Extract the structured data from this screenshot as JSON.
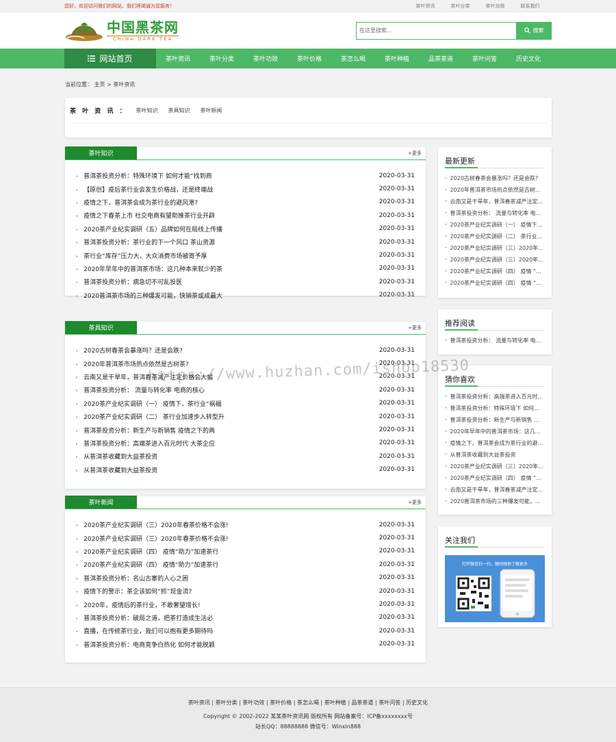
{
  "topbar": {
    "welcome": "您好，欢迎访问我们的网站，我们将竭诚为您服务！",
    "links": [
      "茶叶资讯",
      "茶叶分类",
      "茶叶功效",
      "联系我们"
    ]
  },
  "logo": {
    "cn": "中国黑茶网",
    "en": "CHINA DARK TEA"
  },
  "search": {
    "placeholder": "在这里搜索...",
    "button": "搜索"
  },
  "nav": {
    "home": "网站首页",
    "items": [
      "茶叶资讯",
      "茶叶分类",
      "茶叶功效",
      "茶叶价格",
      "茶怎么喝",
      "茶叶种植",
      "品茶茶道",
      "茶叶问答",
      "历史文化"
    ]
  },
  "breadcrumb": "当前位置： 主页 > 茶叶资讯",
  "category": {
    "title": "茶 叶 资 讯 ：",
    "links": [
      "茶叶知识",
      "茶具知识",
      "茶叶新闻"
    ]
  },
  "panels": [
    {
      "title": "茶叶知识",
      "more": "+更多",
      "items": [
        {
          "t": "普洱茶投资分析：特殊环境下 如何才能“找到商",
          "d": "2020-03-31"
        },
        {
          "t": "【原创】疫后茶行业会发生价格战，还是终端战",
          "d": "2020-03-31"
        },
        {
          "t": "疫情之下，普洱茶会成为茶行业的避风港?",
          "d": "2020-03-31"
        },
        {
          "t": "疫情之下春茶上市 社交电商有望助推茶行业开辟",
          "d": "2020-03-31"
        },
        {
          "t": "2020茶产业纪实调研（五）品牌如何在局线上传播",
          "d": "2020-03-31"
        },
        {
          "t": "普洱茶投资分析：茶行业的下一个风口 茶山资源",
          "d": "2020-03-31"
        },
        {
          "t": "茶行业“库存”压力大，大众消费市场被寄予厚",
          "d": "2020-03-31"
        },
        {
          "t": "2020年早年中的普洱茶市场：这几种本来就少的茶",
          "d": "2020-03-31"
        },
        {
          "t": "普洱茶投资分析：病急切不可乱投医",
          "d": "2020-03-31"
        },
        {
          "t": "2020普洱茶市场的三种爆发可能，快销茶或成最大",
          "d": "2020-03-31"
        }
      ]
    },
    {
      "title": "茶具知识",
      "more": "+更多",
      "items": [
        {
          "t": "2020古树春茶会暴涨吗？还是会跌?",
          "d": "2020-03-31"
        },
        {
          "t": "2020年普洱茶市场热点依然是古树茶?",
          "d": "2020-03-31"
        },
        {
          "t": "云南又是干旱年，普洱春茶减产注定价格会大幅",
          "d": "2020-03-31"
        },
        {
          "t": "普洱茶投资分析： 流量与转化率 电商的核心",
          "d": "2020-03-31"
        },
        {
          "t": "2020茶产业纪实调研（一） 疫情下，茶行业“祸福",
          "d": "2020-03-31"
        },
        {
          "t": "2020茶产业纪实调研（二） 茶行业加速步入转型升",
          "d": "2020-03-31"
        },
        {
          "t": "普洱茶投资分析：新生产与新销售 疫情之下的两",
          "d": "2020-03-31"
        },
        {
          "t": "普洱茶投资分析：高端茶进入百元时代 大茶企应",
          "d": "2020-03-31"
        },
        {
          "t": "从普洱茶收藏到大益茶投资",
          "d": "2020-03-31"
        },
        {
          "t": "从普洱茶收藏到大益茶投资",
          "d": "2020-03-31"
        }
      ]
    },
    {
      "title": "茶叶新闻",
      "more": "+更多",
      "items": [
        {
          "t": "2020茶产业纪实调研（三）2020年春茶价格不会涨!",
          "d": "2020-03-31"
        },
        {
          "t": "2020茶产业纪实调研（三）2020年春茶价格不会涨!",
          "d": "2020-03-31"
        },
        {
          "t": "2020茶产业纪实调研（四） 疫情“助力”加速茶行",
          "d": "2020-03-31"
        },
        {
          "t": "2020茶产业纪实调研（四） 疫情“助力”加速茶行",
          "d": "2020-03-31"
        },
        {
          "t": "普洱茶投资分析：名山古寨的人心之困",
          "d": "2020-03-31"
        },
        {
          "t": "疫情下的警示：茶企该如何“抓”现金流?",
          "d": "2020-03-31"
        },
        {
          "t": "2020年，疫情后的茶行业，不敢奢望增长!",
          "d": "2020-03-31"
        },
        {
          "t": "普洱茶投资分析：破局之道，把茶打造成生活必",
          "d": "2020-03-31"
        },
        {
          "t": "直播，在传统茶行业，我们可以抱有更多期待吗",
          "d": "2020-03-31"
        },
        {
          "t": "普洱茶投资分析：电商竞争白热化 如何才能脱颖",
          "d": "2020-03-31"
        }
      ]
    }
  ],
  "sidebar": {
    "latest": {
      "title": "最新更新",
      "items": [
        "2020古树春茶会暴涨吗？还是会跌?",
        "2020年普洱茶市场热点依然是古树...",
        "云南又是干旱年，普洱春茶减产注定...",
        "普洱茶投资分析： 流量与转化率 电...",
        "2020茶产业纪实调研（一） 疫情下...",
        "2020茶产业纪实调研（二） 茶行业...",
        "2020茶产业纪实调研（三）2020年...",
        "2020茶产业纪实调研（三）2020年...",
        "2020茶产业纪实调研（四） 疫情 “...",
        "2020茶产业纪实调研（四） 疫情 “..."
      ]
    },
    "recommend": {
      "title": "推荐阅读",
      "items": [
        "普洱茶投资分析： 流量与转化率 电..."
      ]
    },
    "guess": {
      "title": "猜你喜欢",
      "items": [
        "普洱茶投资分析：高端茶进入百元时...",
        "普洱茶投资分析：特殊环境下 如何...",
        "普洱茶投资分析：新生产与新销售 ...",
        "2020年早年中的普洱茶市场：这几...",
        "疫情之下，普洱茶会成为茶行业的避...",
        "从普洱茶收藏到大益茶投资",
        "2020茶产业纪实调研（三）2020年...",
        "2020茶产业纪实调研（四） 疫情 “...",
        "云南又是干旱年，普洱春茶减产注定...",
        "2020普洱茶市场的三种爆发可能，..."
      ]
    },
    "follow": {
      "title": "关注我们",
      "qr_text": "打开微信扫一扫，随时随地了解更多"
    }
  },
  "footer": {
    "links": "茶叶资讯 | 茶叶分类 | 茶叶功效 | 茶叶价格 | 茶怎么喝 | 茶叶种植 | 品茶茶道 | 茶叶问答 | 历史文化",
    "copyright": "Copyright © 2002-2022 某某茶叶资讯网 版权所有 网站备案号：ICP备xxxxxxxx号",
    "contact": "站长QQ：88888888 微信号：Winxin888"
  },
  "watermark": "https://www.huzhan.com/ishop18530"
}
